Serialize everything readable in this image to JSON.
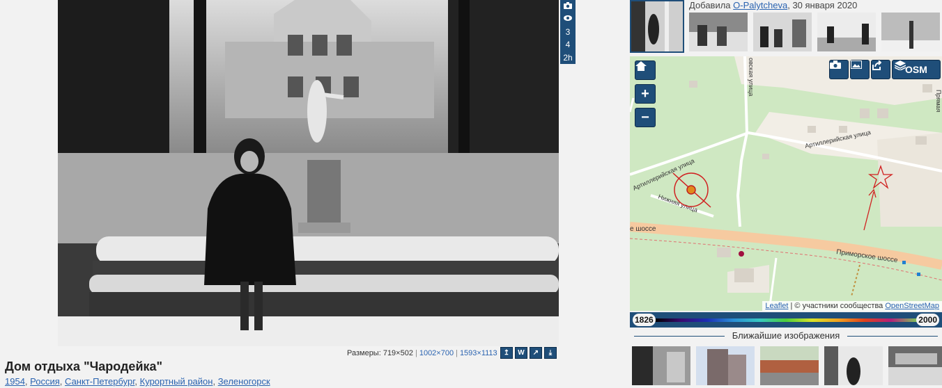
{
  "photo": {
    "title": "Дом отдыха \"Чародейка\"",
    "breadcrumbs": [
      "1954",
      "Россия",
      "Санкт-Петербург",
      "Курортный район",
      "Зеленогорск"
    ]
  },
  "stats": {
    "camera_icon": "camera-icon",
    "eye_icon": "eye-icon",
    "views_day": "3",
    "views_week": "4",
    "age": "2h"
  },
  "sizes": {
    "label": "Размеры: 719×502",
    "size2": "1002×700",
    "size3": "1593×1113",
    "sep": "|"
  },
  "size_buttons": [
    "↥",
    "W",
    "↗",
    "⤓"
  ],
  "added": {
    "prefix": "Добавила",
    "user": "O-Palytcheva",
    "date": ", 30 января 2020"
  },
  "map": {
    "streets": {
      "artill_upper": "Артиллерийская улица",
      "artill_left": "Артиллерийская улица",
      "lower": "Нижняя улица",
      "prim": "Приморское шоссе",
      "shosse_left": "е шоссе",
      "vert": "овская улица",
      "prim_right": "Прямая"
    },
    "tools": {
      "osm": "OSM"
    },
    "attribution_leaflet": "Leaflet",
    "attribution_text": " | © участники сообщества ",
    "attribution_osm": "OpenStreetMap"
  },
  "timeline": {
    "start": "1826",
    "end": "2000"
  },
  "nearest_heading": "Ближайшие изображения",
  "colors": {
    "accent": "#1f4e79",
    "link": "#2a63b0",
    "map_green": "#cfe8c2"
  }
}
